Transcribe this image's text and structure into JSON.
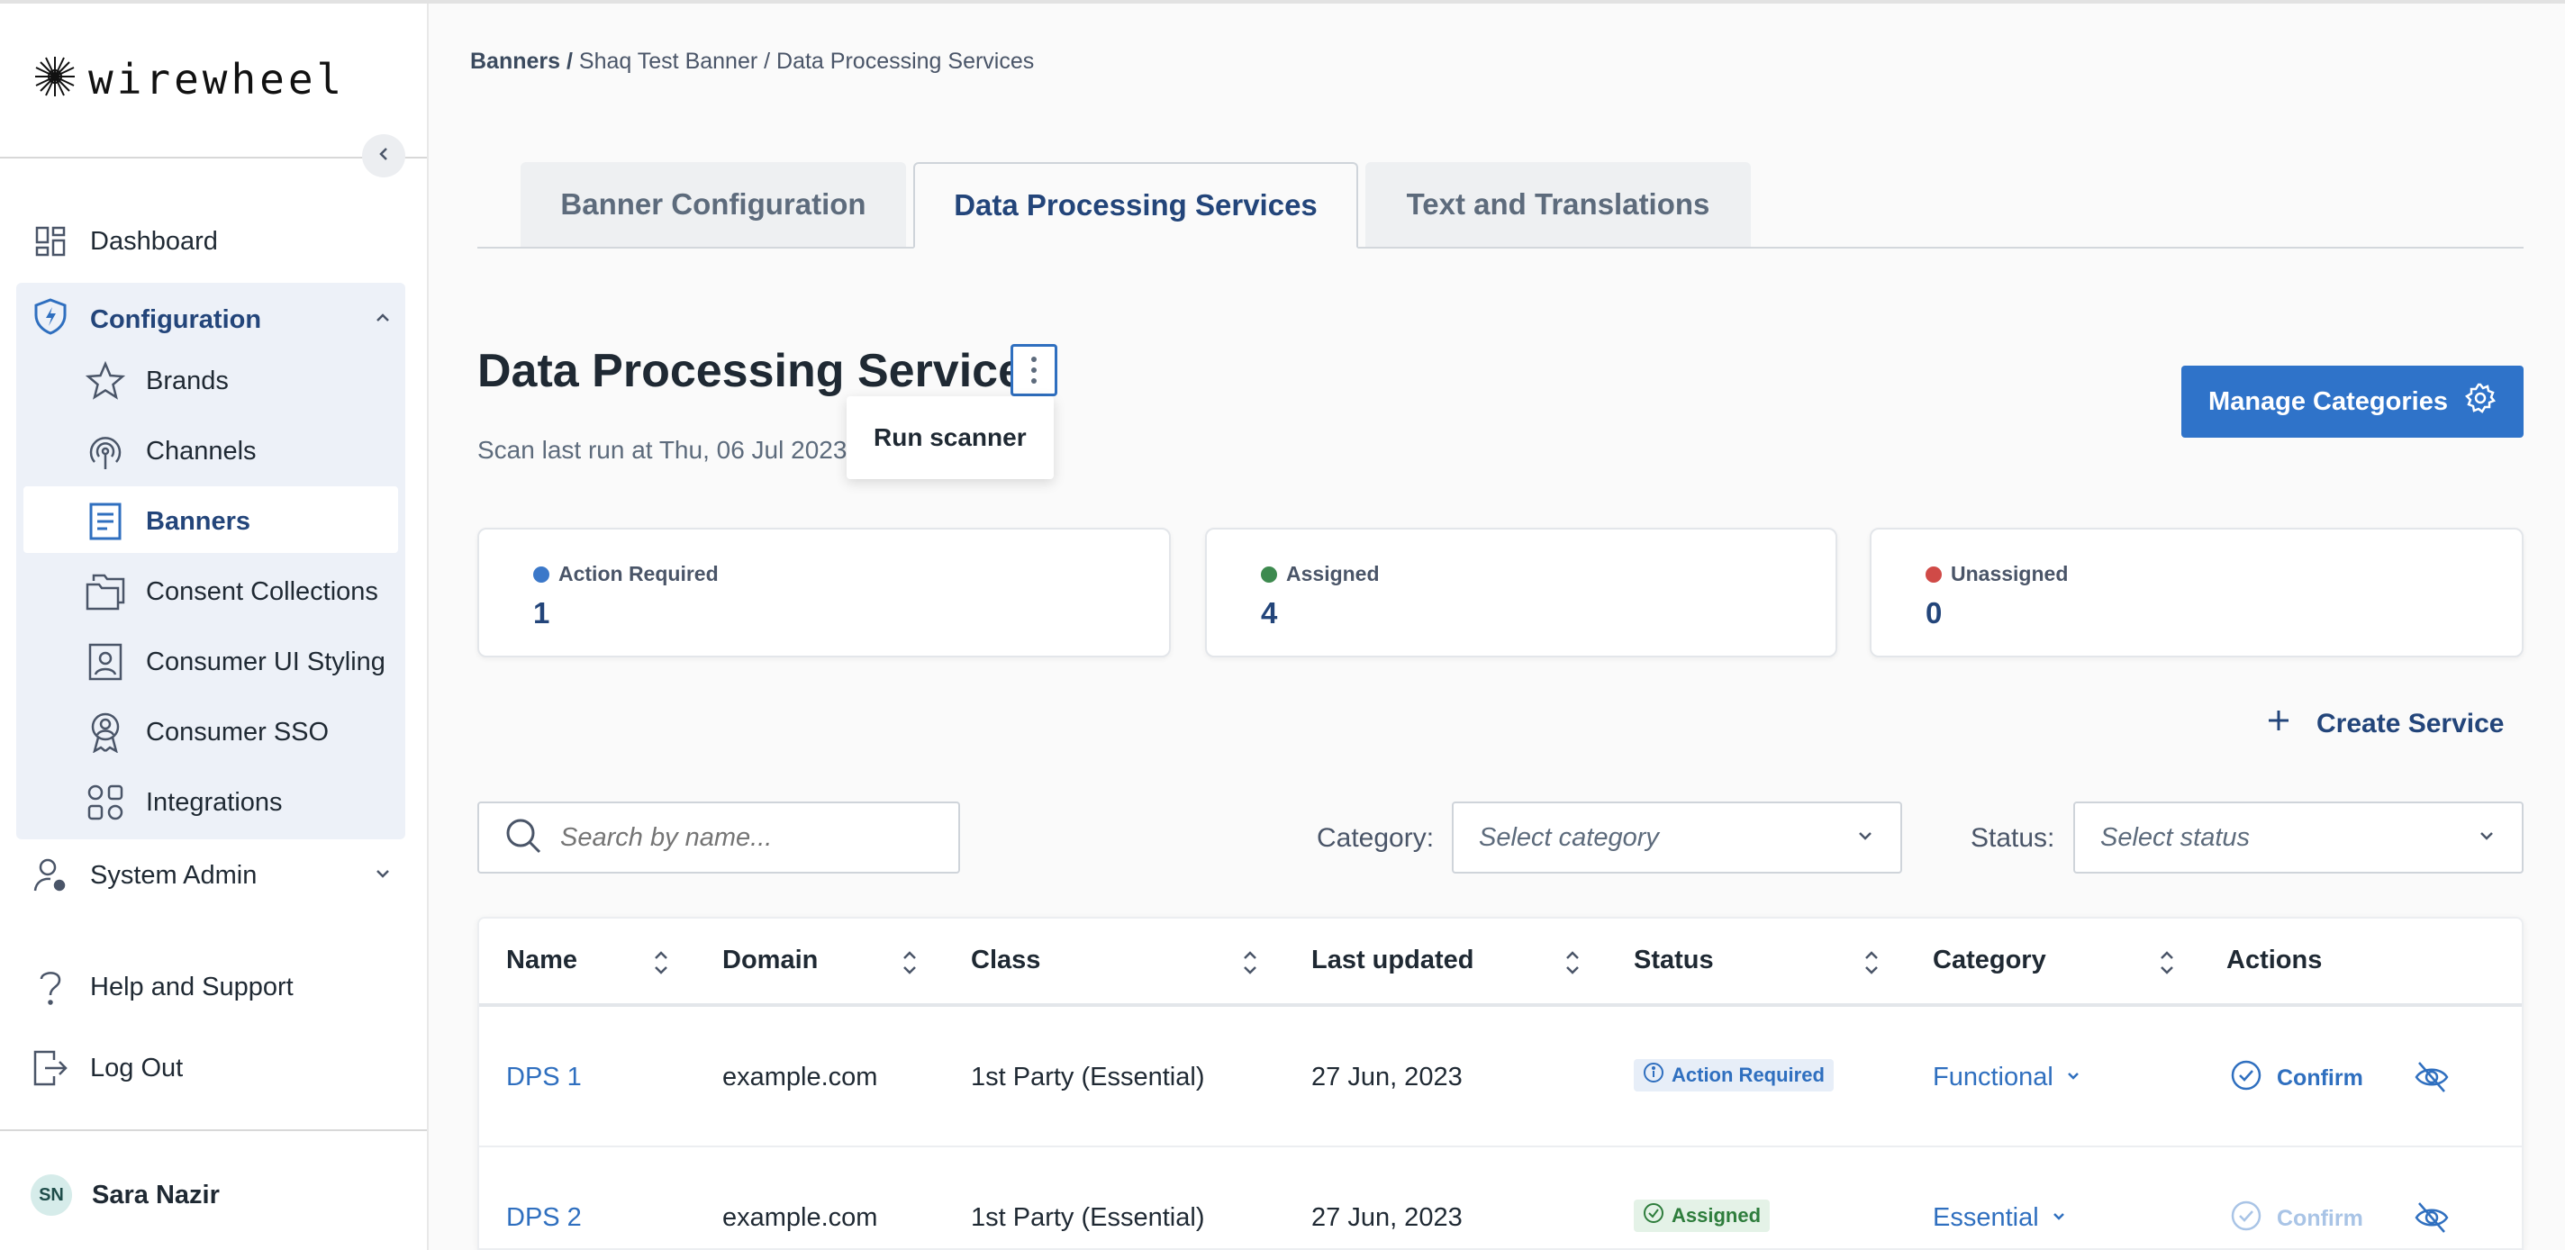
{
  "app": {
    "logo_text": "wirewheel"
  },
  "breadcrumb": {
    "root": "Banners",
    "separator": " / ",
    "banner": "Shaq Test Banner",
    "page": "Data Processing Services"
  },
  "sidebar": {
    "dashboard": "Dashboard",
    "configuration": "Configuration",
    "sub_items": {
      "brands": "Brands",
      "channels": "Channels",
      "banners": "Banners",
      "consent_collections": "Consent Collections",
      "consumer_ui_styling": "Consumer UI Styling",
      "consumer_sso": "Consumer SSO",
      "integrations": "Integrations"
    },
    "system_admin": "System Admin",
    "help": "Help and Support",
    "logout": "Log Out",
    "user": {
      "initials": "SN",
      "name": "Sara Nazir"
    }
  },
  "tabs": {
    "banner_configuration": "Banner Configuration",
    "data_processing_services": "Data Processing Services",
    "text_and_translations": "Text and Translations"
  },
  "page": {
    "title": "Data Processing Services",
    "scan_text": "Scan last run at Thu, 06 Jul 2023",
    "menu_item": "Run scanner",
    "manage_button": "Manage Categories"
  },
  "stats": {
    "action_required": {
      "label": "Action Required",
      "value": "1",
      "color": "#3b78c9"
    },
    "assigned": {
      "label": "Assigned",
      "value": "4",
      "color": "#3d8a4f"
    },
    "unassigned": {
      "label": "Unassigned",
      "value": "0",
      "color": "#d04a47"
    }
  },
  "create_service": "Create Service",
  "filters": {
    "search_placeholder": "Search by name...",
    "category_label": "Category:",
    "category_placeholder": "Select category",
    "status_label": "Status:",
    "status_placeholder": "Select status"
  },
  "table": {
    "headers": {
      "name": "Name",
      "domain": "Domain",
      "class": "Class",
      "last_updated": "Last updated",
      "status": "Status",
      "category": "Category",
      "actions": "Actions"
    },
    "rows": [
      {
        "name": "DPS 1",
        "domain": "example.com",
        "class": "1st Party (Essential)",
        "last_updated": "27 Jun, 2023",
        "status": "Action Required",
        "category": "Functional",
        "action": "Confirm"
      },
      {
        "name": "DPS 2",
        "domain": "example.com",
        "class": "1st Party (Essential)",
        "last_updated": "27 Jun, 2023",
        "status": "Assigned",
        "category": "Essential",
        "action": "Confirm"
      }
    ]
  }
}
